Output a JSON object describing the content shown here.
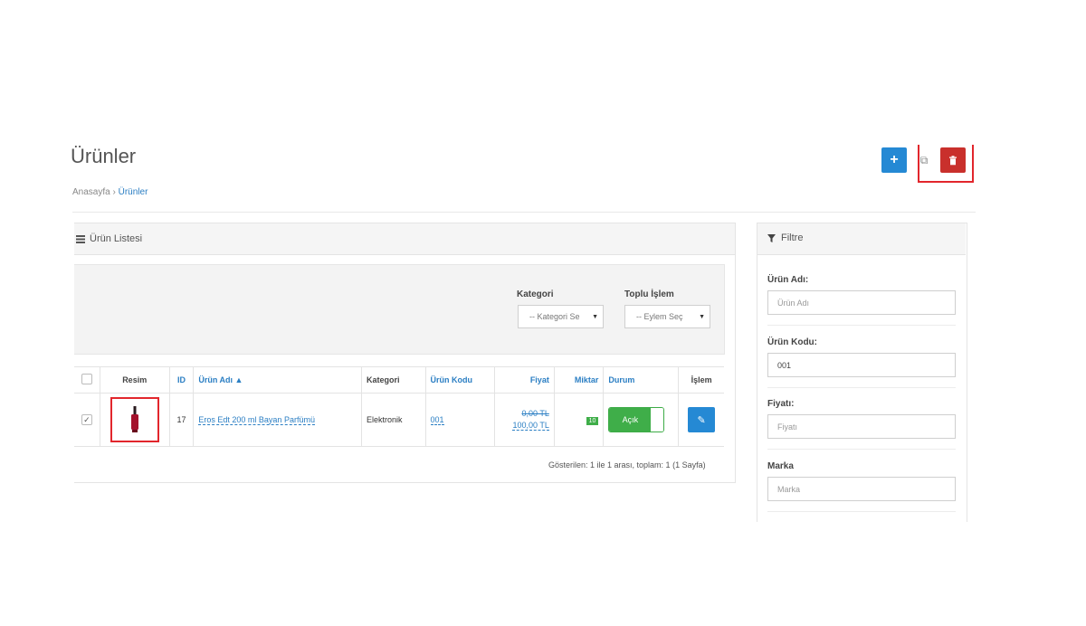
{
  "header": {
    "title": "Ürünler",
    "breadcrumb": {
      "home": "Anasayfa",
      "separator": "›",
      "current": "Ürünler"
    },
    "actions": {
      "add": "+",
      "copy": "⧉",
      "delete": "🗑"
    }
  },
  "list_panel": {
    "title": "Ürün Listesi",
    "filters": {
      "kategori": {
        "label": "Kategori",
        "selected": "-- Kategori Se"
      },
      "toplu_islem": {
        "label": "Toplu İşlem",
        "selected": "-- Eylem Seç"
      }
    },
    "table": {
      "columns": [
        "",
        "Resim",
        "ID",
        "Ürün Adı ▲",
        "Kategori",
        "Ürün Kodu",
        "Fiyat",
        "Miktar",
        "Durum",
        "İşlem"
      ],
      "rows": [
        {
          "checked": "✓",
          "id": "17",
          "name": "Eros Edt 200 ml Bayan Parfümü",
          "category": "Elektronik",
          "code": "001",
          "price_old": "0,00 TL",
          "price": "100,00 TL",
          "quantity": "10",
          "status": "Açık",
          "edit": "✎"
        }
      ]
    },
    "footer": "Gösterilen: 1 ile 1 arası, toplam: 1 (1 Sayfa)"
  },
  "filter_panel": {
    "title": "Filtre",
    "fields": [
      {
        "label": "Ürün Adı:",
        "placeholder": "Ürün Adı",
        "value": ""
      },
      {
        "label": "Ürün Kodu:",
        "placeholder": "",
        "value": "001"
      },
      {
        "label": "Fiyatı:",
        "placeholder": "Fiyatı",
        "value": ""
      },
      {
        "label": "Marka",
        "placeholder": "Marka",
        "value": ""
      }
    ]
  },
  "colors": {
    "primary": "#2589d4",
    "danger": "#c9302c",
    "success": "#3fae49",
    "highlight": "#e2262c"
  }
}
